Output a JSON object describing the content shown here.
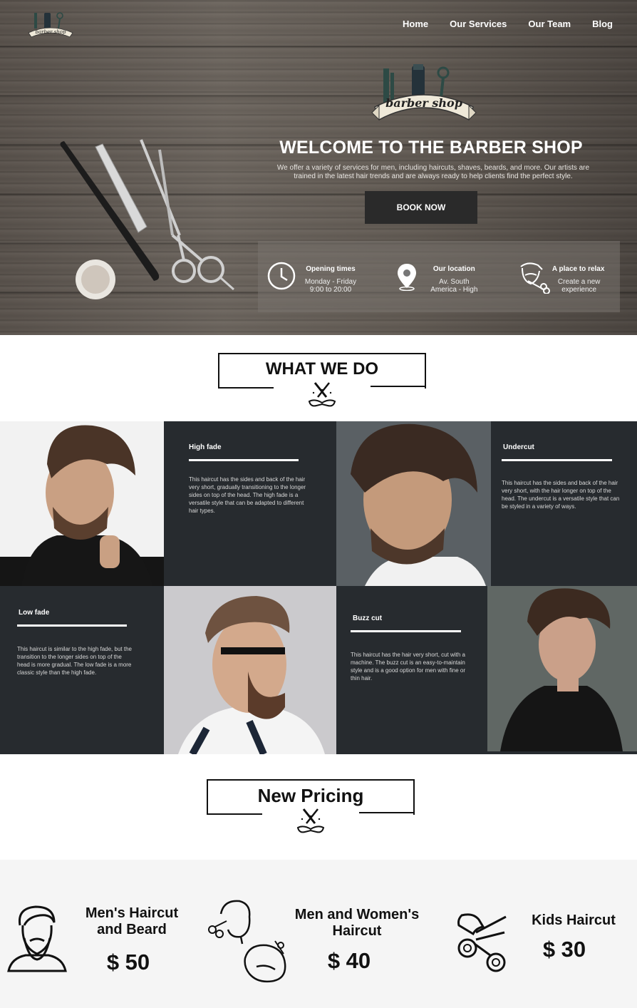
{
  "nav": {
    "items": [
      {
        "label": "Home"
      },
      {
        "label": "Our Services"
      },
      {
        "label": "Our Team"
      },
      {
        "label": "Blog"
      }
    ]
  },
  "hero": {
    "logo_text": "barber shop",
    "title": "WELCOME TO THE BARBER SHOP",
    "description": "We offer a variety of services for men, including haircuts, shaves, beards, and more. Our artists are trained in the latest hair trends and are always ready to help clients find the perfect style.",
    "button_label": "BOOK NOW",
    "info": [
      {
        "icon": "clock-icon",
        "title": "Opening times",
        "line1": "Monday - Friday",
        "line2": "9:00 to 20:00"
      },
      {
        "icon": "location-pin-icon",
        "title": "Our location",
        "line1": "Av. South",
        "line2": "America - High"
      },
      {
        "icon": "barber-face-icon",
        "title": "A place to relax",
        "line1": "Create a new",
        "line2": "experience"
      }
    ]
  },
  "what_we_do": {
    "title": "WHAT WE DO",
    "cards": [
      {
        "title": "High fade",
        "text": "This haircut has the sides and back of the hair very short, gradually transitioning to the longer sides on top of the head. The high fade is a versatile style that can be adapted to different hair types."
      },
      {
        "title": "Undercut",
        "text": "This haircut has the sides and back of the hair very short, with the hair longer on top of the head. The undercut is a versatile style that can be styled in a variety of ways."
      },
      {
        "title": "Low fade",
        "text": "This haircut is similar to the high fade, but the transition to the longer sides on top of the head is more gradual. The low fade is a more classic style than the high fade."
      },
      {
        "title": "Buzz cut",
        "text": "This haircut has the hair very short, cut with a machine. The buzz cut is an easy-to-maintain style and is a good option for men with fine or thin hair."
      }
    ]
  },
  "pricing": {
    "title": "New Pricing",
    "items": [
      {
        "name_line1": "Men's Haircut",
        "name_line2": "and Beard",
        "price": "$ 50",
        "icon": "bearded-man-icon"
      },
      {
        "name_line1": "Men and Women's",
        "name_line2": "Haircut",
        "price": "$ 40",
        "icon": "man-woman-haircut-icon"
      },
      {
        "name_line1": "Kids Haircut",
        "name_line2": "",
        "price": "$ 30",
        "icon": "scissors-icon"
      }
    ]
  },
  "colors": {
    "dark_card": "#272b2f",
    "book_button": "#2a2a2a",
    "pricing_bg": "#f5f5f5"
  }
}
